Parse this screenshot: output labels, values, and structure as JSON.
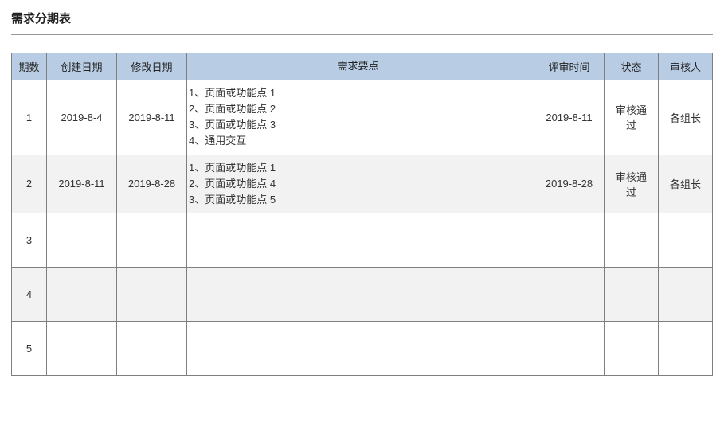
{
  "title": "需求分期表",
  "chart_data": {
    "type": "table",
    "headers": [
      "期数",
      "创建日期",
      "修改日期",
      "需求要点",
      "评审时间",
      "状态",
      "审核人"
    ],
    "rows": [
      {
        "num": "1",
        "create_date": "2019-8-4",
        "modify_date": "2019-8-11",
        "points": "1、页面或功能点 1\n2、页面或功能点 2\n3、页面或功能点 3\n4、通用交互",
        "review_time": "2019-8-11",
        "status": "审核通过",
        "auditor": "各组长"
      },
      {
        "num": "2",
        "create_date": "2019-8-11",
        "modify_date": "2019-8-28",
        "points": "1、页面或功能点 1\n2、页面或功能点 4\n3、页面或功能点 5",
        "review_time": "2019-8-28",
        "status": "审核通过",
        "auditor": "各组长"
      },
      {
        "num": "3",
        "create_date": "",
        "modify_date": "",
        "points": "",
        "review_time": "",
        "status": "",
        "auditor": ""
      },
      {
        "num": "4",
        "create_date": "",
        "modify_date": "",
        "points": "",
        "review_time": "",
        "status": "",
        "auditor": ""
      },
      {
        "num": "5",
        "create_date": "",
        "modify_date": "",
        "points": "",
        "review_time": "",
        "status": "",
        "auditor": ""
      }
    ]
  }
}
